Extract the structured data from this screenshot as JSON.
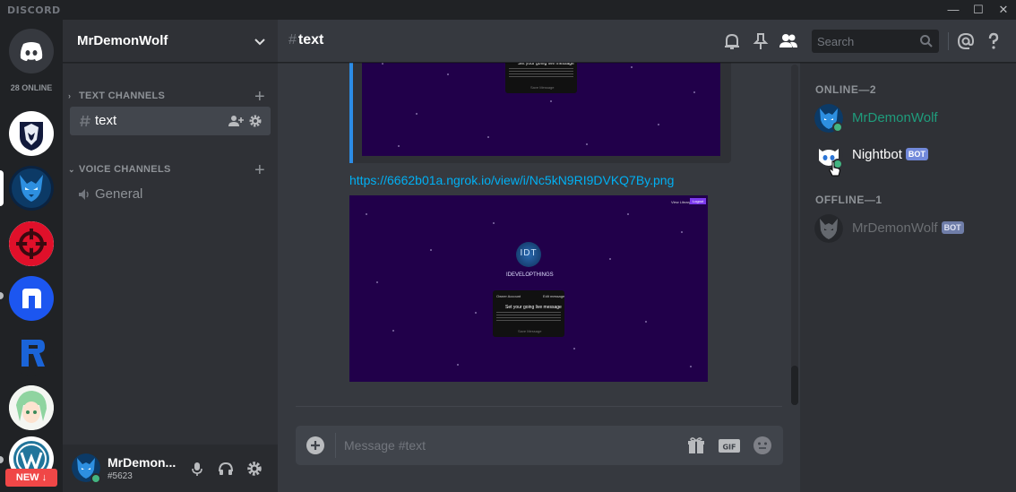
{
  "window": {
    "app_logo": "DISCORD",
    "minimize": "—",
    "maximize": "☐",
    "close": "✕"
  },
  "servers": {
    "online_count": "28 ONLINE",
    "new_badge": "NEW ↓",
    "icons": [
      {
        "name": "home-discord",
        "color": "#ffffff"
      },
      {
        "name": "wolf-shield",
        "color": "#101a3a"
      },
      {
        "name": "wolf-blue",
        "color": "#0b3b66"
      },
      {
        "name": "crosshair",
        "color": "#e0102a"
      },
      {
        "name": "letter-n",
        "color": "#1c56f0"
      },
      {
        "name": "letter-r",
        "color": "#1a64d8"
      },
      {
        "name": "anime-avatar",
        "color": "#cfe8cf"
      },
      {
        "name": "wordpress",
        "color": "#21759b"
      }
    ]
  },
  "guild": {
    "name": "MrDemonWolf"
  },
  "categories": {
    "text": "TEXT CHANNELS",
    "voice": "VOICE CHANNELS"
  },
  "channels": {
    "text": "text",
    "voice": "General"
  },
  "user": {
    "name": "MrDemon...",
    "tag": "#5623"
  },
  "header": {
    "channel": "text",
    "hash": "#",
    "search_placeholder": "Search"
  },
  "messages": {
    "link": "https://6662b01a.ngrok.io/view/i/Nc5kN9RI9DVKQ7By.png",
    "preview": {
      "nav_left": "View Library",
      "nav_right": "Logout",
      "logo": "IDT",
      "brand": "IDEVELOPTHINGS",
      "card_user": "Owner Account",
      "card_tag": "Edit message",
      "card_title": "Set your going live message",
      "card_footer": "Save Message"
    }
  },
  "composer": {
    "placeholder": "Message #text"
  },
  "members": {
    "online_heading": "ONLINE—2",
    "offline_heading": "OFFLINE—1",
    "online": [
      {
        "name": "MrDemonWolf",
        "color": "#1f9c7c",
        "bot": ""
      },
      {
        "name": "Nightbot",
        "color": "#ffffff",
        "bot": "BOT"
      }
    ],
    "offline": [
      {
        "name": "MrDemonWolf",
        "bot": "BOT"
      }
    ]
  },
  "colors": {
    "accent": "#7289da",
    "online": "#43b581",
    "link": "#00b0f4",
    "danger": "#f04747"
  }
}
